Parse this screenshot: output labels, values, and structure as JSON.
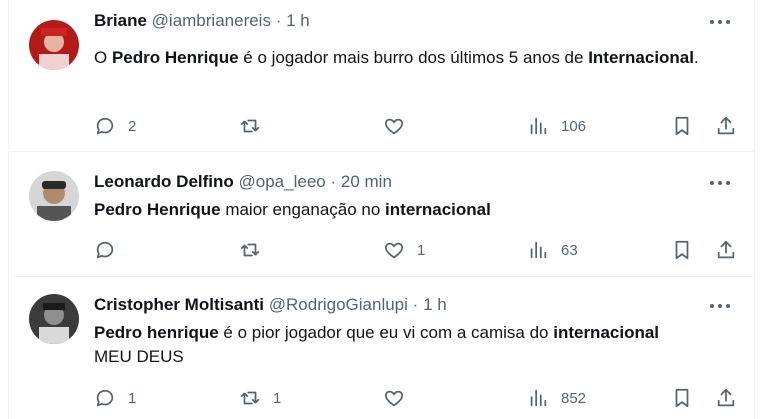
{
  "tweets": [
    {
      "name": "Briane",
      "handle": "@iambrianereis",
      "separator": "·",
      "time": "1 h",
      "text_parts": [
        {
          "t": "O ",
          "b": false
        },
        {
          "t": "Pedro Henrique",
          "b": true
        },
        {
          "t": " é o jogador mais burro dos últimos 5 anos de ",
          "b": false
        },
        {
          "t": "Internacional",
          "b": true
        },
        {
          "t": ".",
          "b": false
        }
      ],
      "replies": "2",
      "retweets": "",
      "likes": "",
      "views": "106",
      "avatar_colors": [
        "#b31b1b",
        "#f2c6c6"
      ]
    },
    {
      "name": "Leonardo Delfino",
      "handle": "@opa_leeo",
      "separator": "·",
      "time": "20 min",
      "text_parts": [
        {
          "t": "Pedro Henrique",
          "b": true
        },
        {
          "t": " maior enganação no ",
          "b": false
        },
        {
          "t": "internacional",
          "b": true
        }
      ],
      "replies": "",
      "retweets": "",
      "likes": "1",
      "views": "63",
      "avatar_colors": [
        "#3a3a3a",
        "#c9b8a6"
      ]
    },
    {
      "name": "Cristopher Moltisanti",
      "handle": "@RodrigoGianlupi",
      "separator": "·",
      "time": "1 h",
      "text_parts": [
        {
          "t": "Pedro henrique",
          "b": true
        },
        {
          "t": " é o pior jogador que eu vi com a camisa do ",
          "b": false
        },
        {
          "t": "internacional",
          "b": true
        },
        {
          "t": "\nMEU DEUS",
          "b": false
        }
      ],
      "replies": "1",
      "retweets": "1",
      "likes": "",
      "views": "852",
      "avatar_colors": [
        "#2b2b2b",
        "#9a9a9a"
      ]
    }
  ],
  "icons": {
    "more": "more-horizontal-icon",
    "reply": "reply-icon",
    "retweet": "retweet-icon",
    "like": "heart-icon",
    "views": "views-chart-icon",
    "bookmark": "bookmark-icon",
    "share": "share-icon"
  },
  "colors": {
    "text": "#0f1419",
    "secondary": "#536471",
    "border": "#eff3f4"
  }
}
